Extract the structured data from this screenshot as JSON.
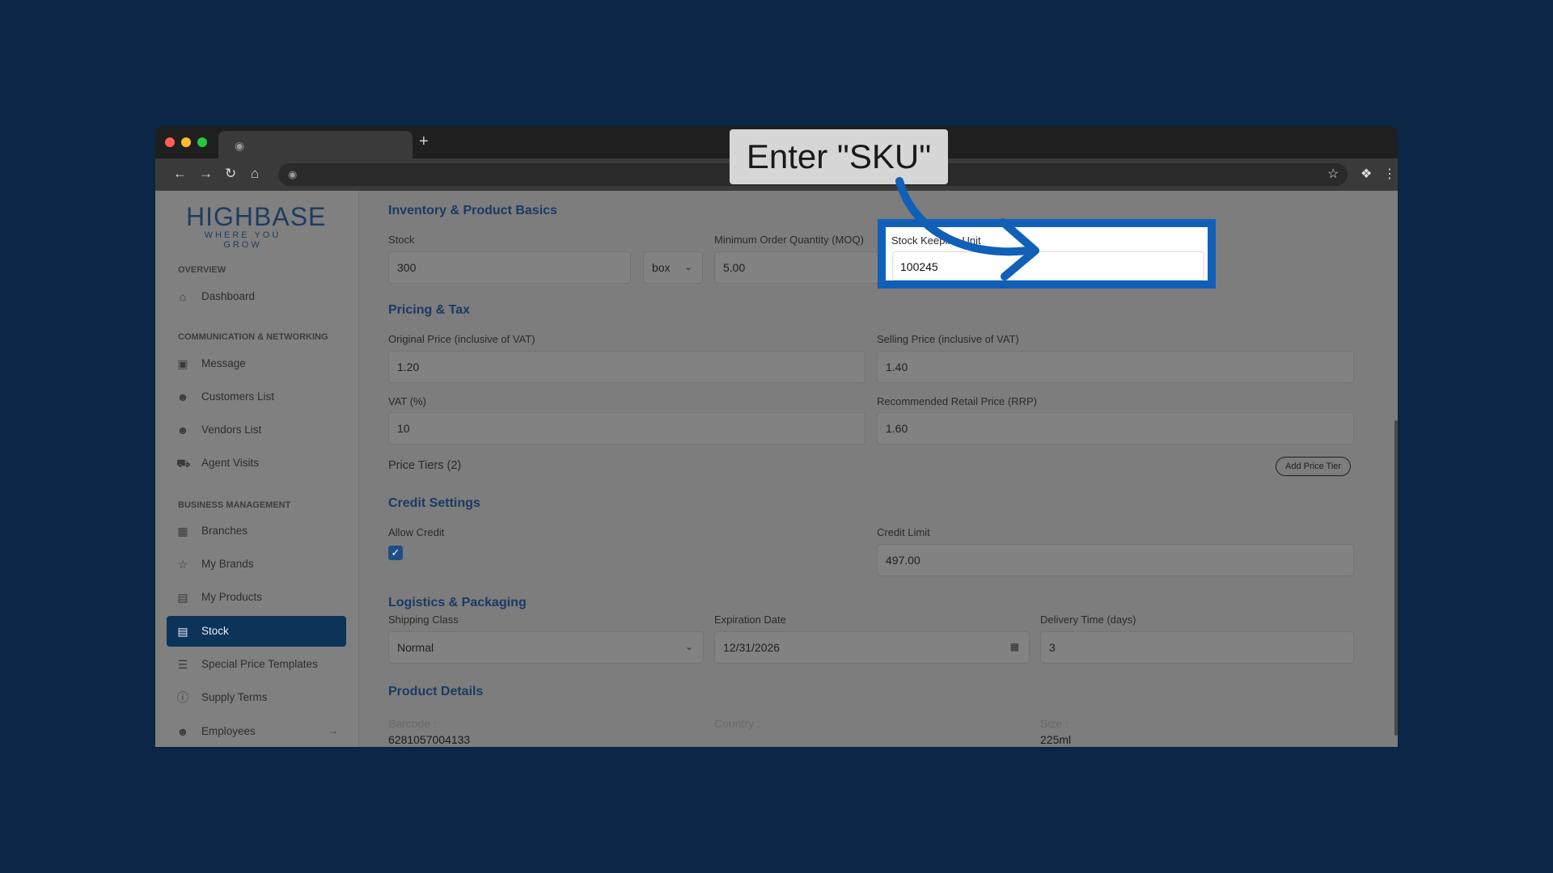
{
  "browser": {
    "new_tab": "+",
    "icons": [
      "back-icon",
      "forward-icon",
      "reload-icon",
      "home-icon",
      "globe-icon",
      "star-icon",
      "extensions-icon",
      "menu-icon"
    ]
  },
  "callout": {
    "text": "Enter \"SKU\""
  },
  "sidebar": {
    "logo": {
      "wordmark": "HIGHBASE",
      "tagline": "WHERE YOU GROW"
    },
    "sections": {
      "overview": "OVERVIEW",
      "comms": "COMMUNICATION & NETWORKING",
      "business": "BUSINESS MANAGEMENT"
    },
    "items": [
      {
        "label": "Dashboard",
        "icon": "home-icon"
      },
      {
        "label": "Message",
        "icon": "cube-icon"
      },
      {
        "label": "Customers List",
        "icon": "users-icon"
      },
      {
        "label": "Vendors List",
        "icon": "users-icon"
      },
      {
        "label": "Agent Visits",
        "icon": "truck-icon"
      },
      {
        "label": "Branches",
        "icon": "building-icon"
      },
      {
        "label": "My Brands",
        "icon": "star-icon"
      },
      {
        "label": "My Products",
        "icon": "archive-icon"
      },
      {
        "label": "Stock",
        "icon": "archive-icon",
        "active": true
      },
      {
        "label": "Special Price Templates",
        "icon": "list-icon"
      },
      {
        "label": "Supply Terms",
        "icon": "info-icon"
      },
      {
        "label": "Employees",
        "icon": "users-icon"
      }
    ]
  },
  "inventory": {
    "title": "Inventory & Product Basics",
    "stock_label": "Stock",
    "stock_value": "300",
    "unit_value": "box",
    "moq_label": "Minimum Order Quantity (MOQ)",
    "moq_value": "5.00",
    "sku_label": "Stock Keeping Unit",
    "sku_value": "100245"
  },
  "pricing": {
    "title": "Pricing & Tax",
    "original_label": "Original Price (inclusive of VAT)",
    "original_value": "1.20",
    "selling_label": "Selling Price (inclusive of VAT)",
    "selling_value": "1.40",
    "vat_label": "VAT (%)",
    "vat_value": "10",
    "rrp_label": "Recommended Retail Price (RRP)",
    "rrp_value": "1.60",
    "tiers_label": "Price Tiers (2)",
    "add_tier_button": "Add Price Tier"
  },
  "credit": {
    "title": "Credit Settings",
    "allow_label": "Allow Credit",
    "allow_checked": true,
    "limit_label": "Credit Limit",
    "limit_value": "497.00"
  },
  "logistics": {
    "title": "Logistics & Packaging",
    "shipping_label": "Shipping Class",
    "shipping_value": "Normal",
    "expiration_label": "Expiration Date",
    "expiration_value": "12/31/2026",
    "delivery_label": "Delivery Time (days)",
    "delivery_value": "3"
  },
  "product_details": {
    "title": "Product Details",
    "barcode_label": "Barcode :",
    "barcode_value": "6281057004133",
    "country_label": "Country :",
    "size_label": "Size :",
    "size_value": "225ml"
  },
  "colors": {
    "background": "#0b2646",
    "highlight_border": "#1060b8",
    "active_nav": "#0c3358",
    "section_title": "#1b3a63"
  }
}
